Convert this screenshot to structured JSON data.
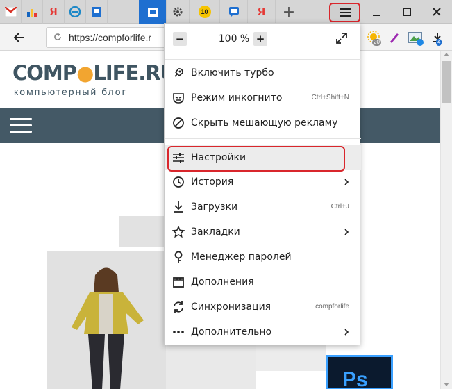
{
  "colors": {
    "highlight_red": "#d9262c",
    "site_nav": "#445966",
    "logo_accent": "#f2a530",
    "tab_active": "#1e6fd0"
  },
  "tabs": [
    {
      "icon": "gmail-icon"
    },
    {
      "icon": "chart-favicon-icon"
    },
    {
      "icon": "yandex-icon",
      "glyph": "Я"
    },
    {
      "icon": "blue-e-icon"
    },
    {
      "icon": "blue-square-icon"
    },
    {
      "icon": "blue-square-icon",
      "active": true
    },
    {
      "icon": "gear-icon"
    },
    {
      "icon": "number-ten-icon",
      "glyph": "10"
    },
    {
      "icon": "chat-bubble-icon"
    },
    {
      "icon": "yandex-icon",
      "glyph": "Я"
    }
  ],
  "tabbar": {
    "new_tab": "+"
  },
  "address": {
    "url": "https://compforlife.r"
  },
  "extensions": {
    "weather_badge": "20",
    "download_badge": "4"
  },
  "site": {
    "logo_left": "COMP",
    "logo_for": "FOR",
    "logo_right": "LIFE.RU",
    "tagline": "компьютерный блог",
    "ps_label": "Ps"
  },
  "menu": {
    "zoom_minus": "−",
    "zoom_value": "100 %",
    "zoom_plus": "+",
    "items": [
      {
        "label": "Включить турбо",
        "icon": "turbo-rocket-icon"
      },
      {
        "label": "Режим инкогнито",
        "icon": "incognito-mask-icon",
        "shortcut": "Ctrl+Shift+N"
      },
      {
        "label": "Скрыть мешающую рекламу",
        "icon": "block-ads-icon"
      },
      {
        "label": "Настройки",
        "icon": "settings-sliders-icon",
        "highlighted": true
      },
      {
        "label": "История",
        "icon": "history-clock-icon",
        "submenu": true
      },
      {
        "label": "Загрузки",
        "icon": "download-icon",
        "shortcut": "Ctrl+J"
      },
      {
        "label": "Закладки",
        "icon": "bookmark-star-icon",
        "submenu": true
      },
      {
        "label": "Менеджер паролей",
        "icon": "key-icon"
      },
      {
        "label": "Дополнения",
        "icon": "extensions-icon"
      },
      {
        "label": "Синхронизация",
        "icon": "sync-icon",
        "shortcut": "compforlife"
      },
      {
        "label": "Дополнительно",
        "icon": "more-dots-icon",
        "submenu": true
      }
    ]
  }
}
